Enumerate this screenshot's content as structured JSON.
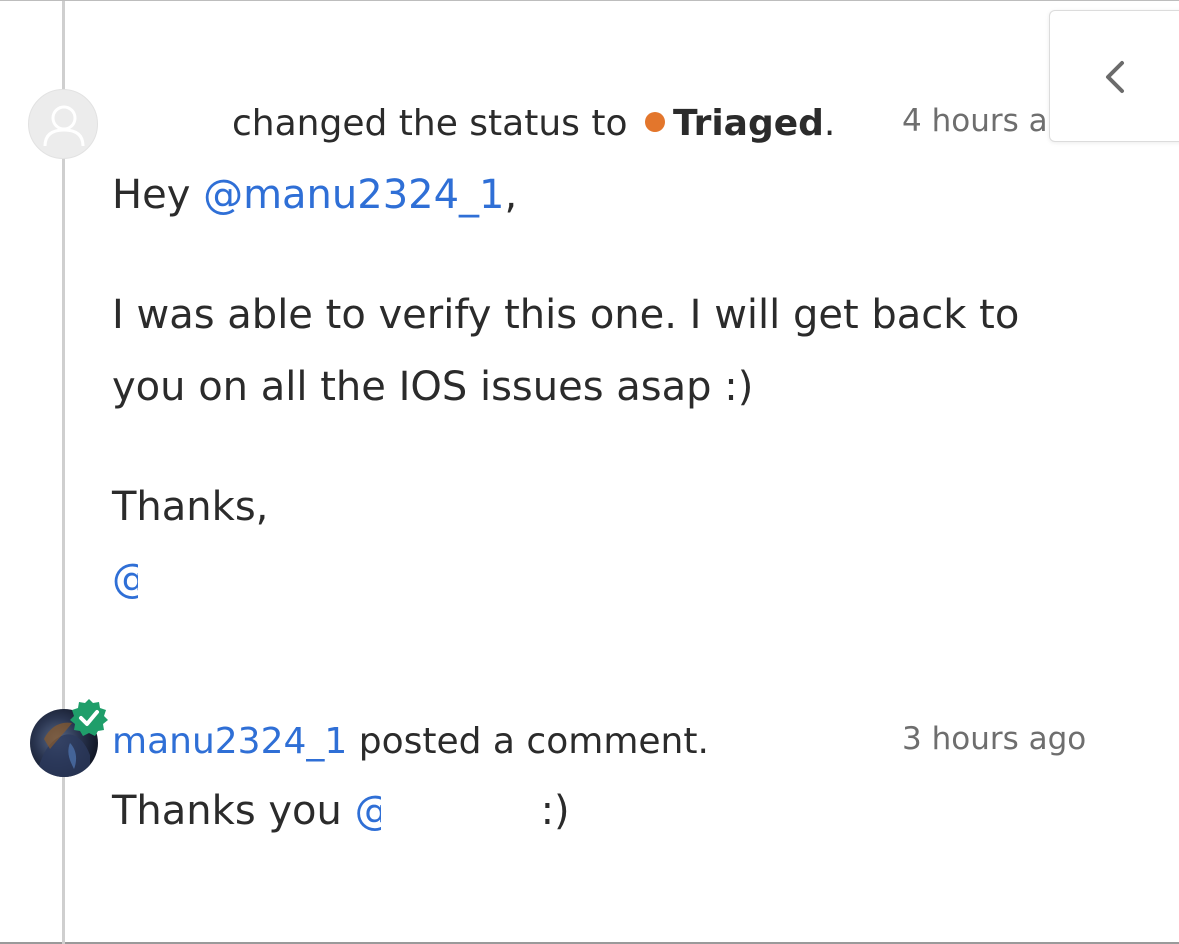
{
  "back_button": {
    "icon": "chevron-left-icon"
  },
  "status_event": {
    "action_text": "changed the status to",
    "status_name": "Triaged",
    "status_suffix": ".",
    "status_color": "#e3762c",
    "timestamp": "4 hours a"
  },
  "comment": {
    "greeting_prefix": "Hey ",
    "mention": "@manu2324_1",
    "greeting_suffix": ",",
    "paragraph_line1": "I was able to verify this one. I will get back to",
    "paragraph_line2": "you on all the IOS issues asap :)",
    "signoff": "Thanks,",
    "signature_mention": "@"
  },
  "reply_event": {
    "username": "manu2324_1",
    "action_text": " posted a comment.",
    "timestamp": "3 hours ago",
    "verified_icon": "verified-badge-icon",
    "body_prefix": "Thanks you ",
    "body_mention": "@",
    "body_suffix": ":)"
  },
  "colors": {
    "link": "#2f6fd6",
    "text": "#2b2b2b",
    "muted": "#6e6e6e",
    "verified": "#1f9e6a"
  }
}
